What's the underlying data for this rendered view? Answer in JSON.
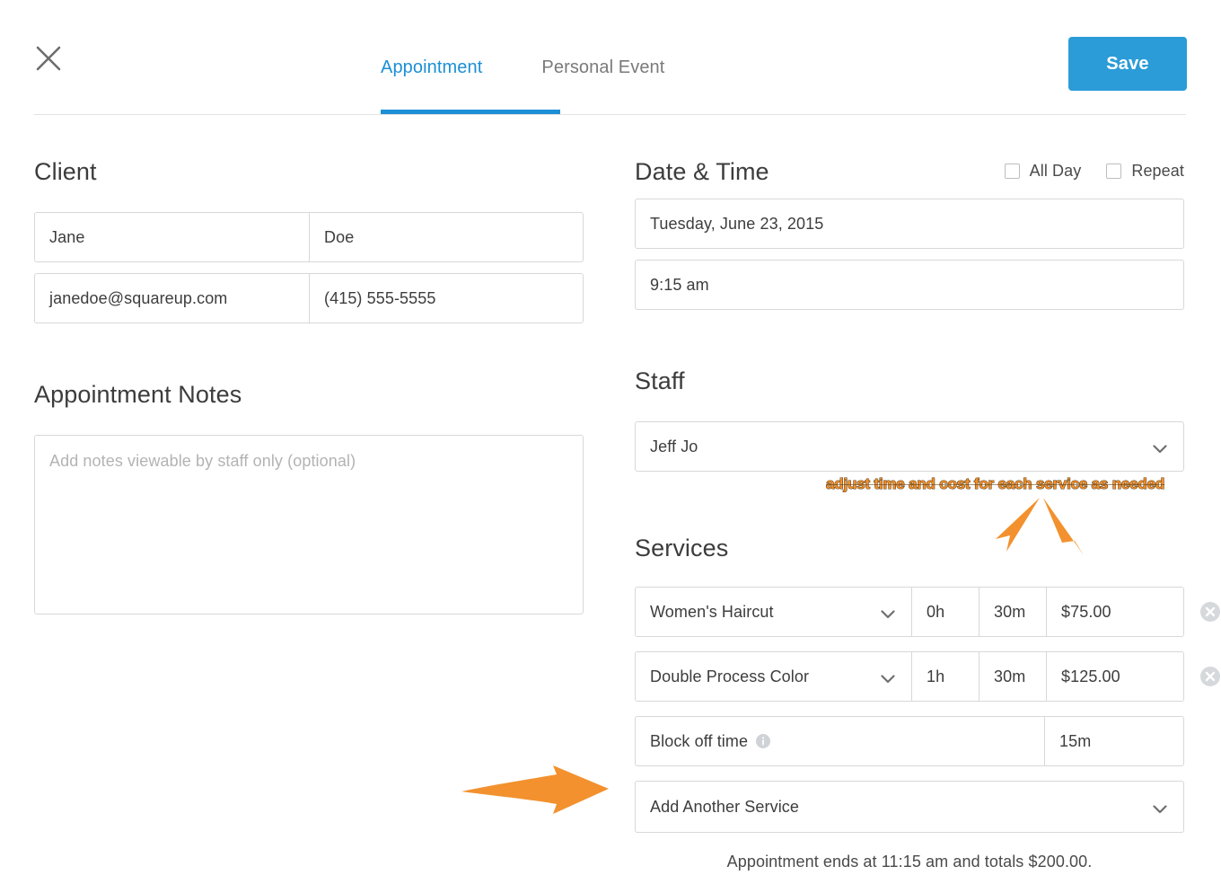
{
  "header": {
    "close_icon": "close-icon",
    "tabs": [
      {
        "label": "Appointment",
        "active": true
      },
      {
        "label": "Personal Event",
        "active": false
      }
    ],
    "save_label": "Save",
    "accent_color": "#1c8fd6",
    "save_button_color": "#2b9cd8"
  },
  "client": {
    "title": "Client",
    "first_name": "Jane",
    "last_name": "Doe",
    "email": "janedoe@squareup.com",
    "phone": "(415) 555-5555"
  },
  "notes": {
    "title": "Appointment Notes",
    "placeholder": "Add notes viewable by staff only (optional)",
    "value": ""
  },
  "date_time": {
    "title": "Date & Time",
    "all_day_label": "All Day",
    "all_day_checked": false,
    "repeat_label": "Repeat",
    "repeat_checked": false,
    "date": "Tuesday, June 23, 2015",
    "time": "9:15 am"
  },
  "staff": {
    "title": "Staff",
    "selected": "Jeff Jo"
  },
  "services": {
    "title": "Services",
    "rows": [
      {
        "name": "Women's Haircut",
        "hours": "0h",
        "minutes": "30m",
        "price": "$75.00",
        "removable": true
      },
      {
        "name": "Double Process Color",
        "hours": "1h",
        "minutes": "30m",
        "price": "$125.00",
        "removable": true
      }
    ],
    "block_off": {
      "label": "Block off time",
      "info_icon": "info-icon",
      "duration": "15m"
    },
    "add_another_label": "Add Another Service",
    "summary": "Appointment ends at 11:15 am and totals $200.00."
  },
  "annotations": {
    "callout_text": "adjust time and cost for each service as needed",
    "callout_color": "#F2912E",
    "arrow_color": "#F2912E"
  }
}
